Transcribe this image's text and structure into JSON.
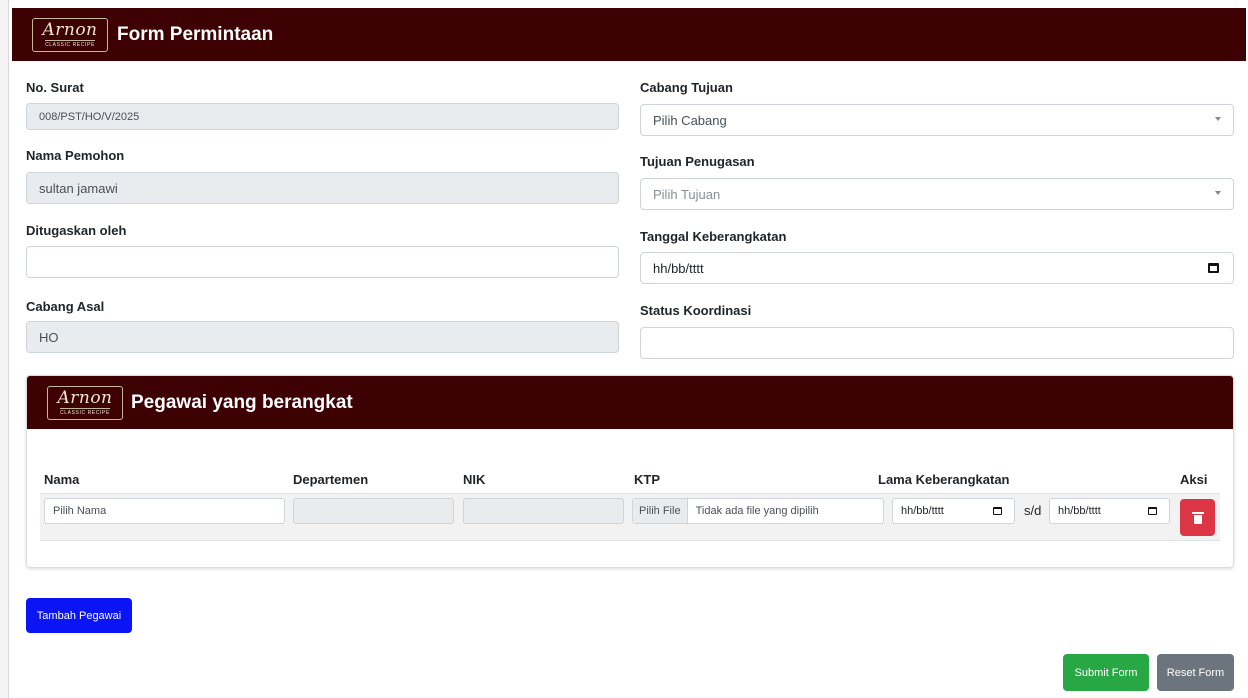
{
  "header": {
    "logo_text": "Arnon",
    "logo_sub": "CLASSIC RECIPE",
    "title": "Form Permintaan"
  },
  "left": {
    "no_surat": {
      "label": "No. Surat",
      "value": "008/PST/HO/V/2025"
    },
    "nama_pemohon": {
      "label": "Nama Pemohon",
      "value": "sultan jamawi"
    },
    "ditugaskan_oleh": {
      "label": "Ditugaskan oleh",
      "value": ""
    },
    "cabang_asal": {
      "label": "Cabang Asal",
      "value": "HO"
    }
  },
  "right": {
    "cabang_tujuan": {
      "label": "Cabang Tujuan",
      "placeholder": "Pilih Cabang"
    },
    "tujuan_penugasan": {
      "label": "Tujuan Penugasan",
      "placeholder": "Pilih Tujuan"
    },
    "tanggal_keberangkatan": {
      "label": "Tanggal Keberangkatan",
      "placeholder": "hh/bb/tttt"
    },
    "status_koordinasi": {
      "label": "Status Koordinasi",
      "value": ""
    }
  },
  "employees": {
    "title": "Pegawai yang berangkat",
    "columns": [
      "Nama",
      "Departemen",
      "NIK",
      "KTP",
      "Lama Keberangkatan",
      "Aksi"
    ],
    "row": {
      "nama_placeholder": "Pilih Nama",
      "file_button": "Pilih File",
      "file_text": "Tidak ada file yang dipilih",
      "date_start": "hh/bb/tttt",
      "separator": "s/d",
      "date_end": "hh/bb/tttt"
    }
  },
  "buttons": {
    "add": "Tambah Pegawai",
    "submit": "Submit Form",
    "reset": "Reset Form"
  },
  "colors": {
    "header": "#3d0104",
    "add": "#0a14f5",
    "submit": "#28a745",
    "reset": "#6c757d",
    "delete": "#dc3545"
  },
  "icons": {
    "select": "chevron-down-icon",
    "date": "calendar-icon",
    "delete": "trash-icon"
  }
}
